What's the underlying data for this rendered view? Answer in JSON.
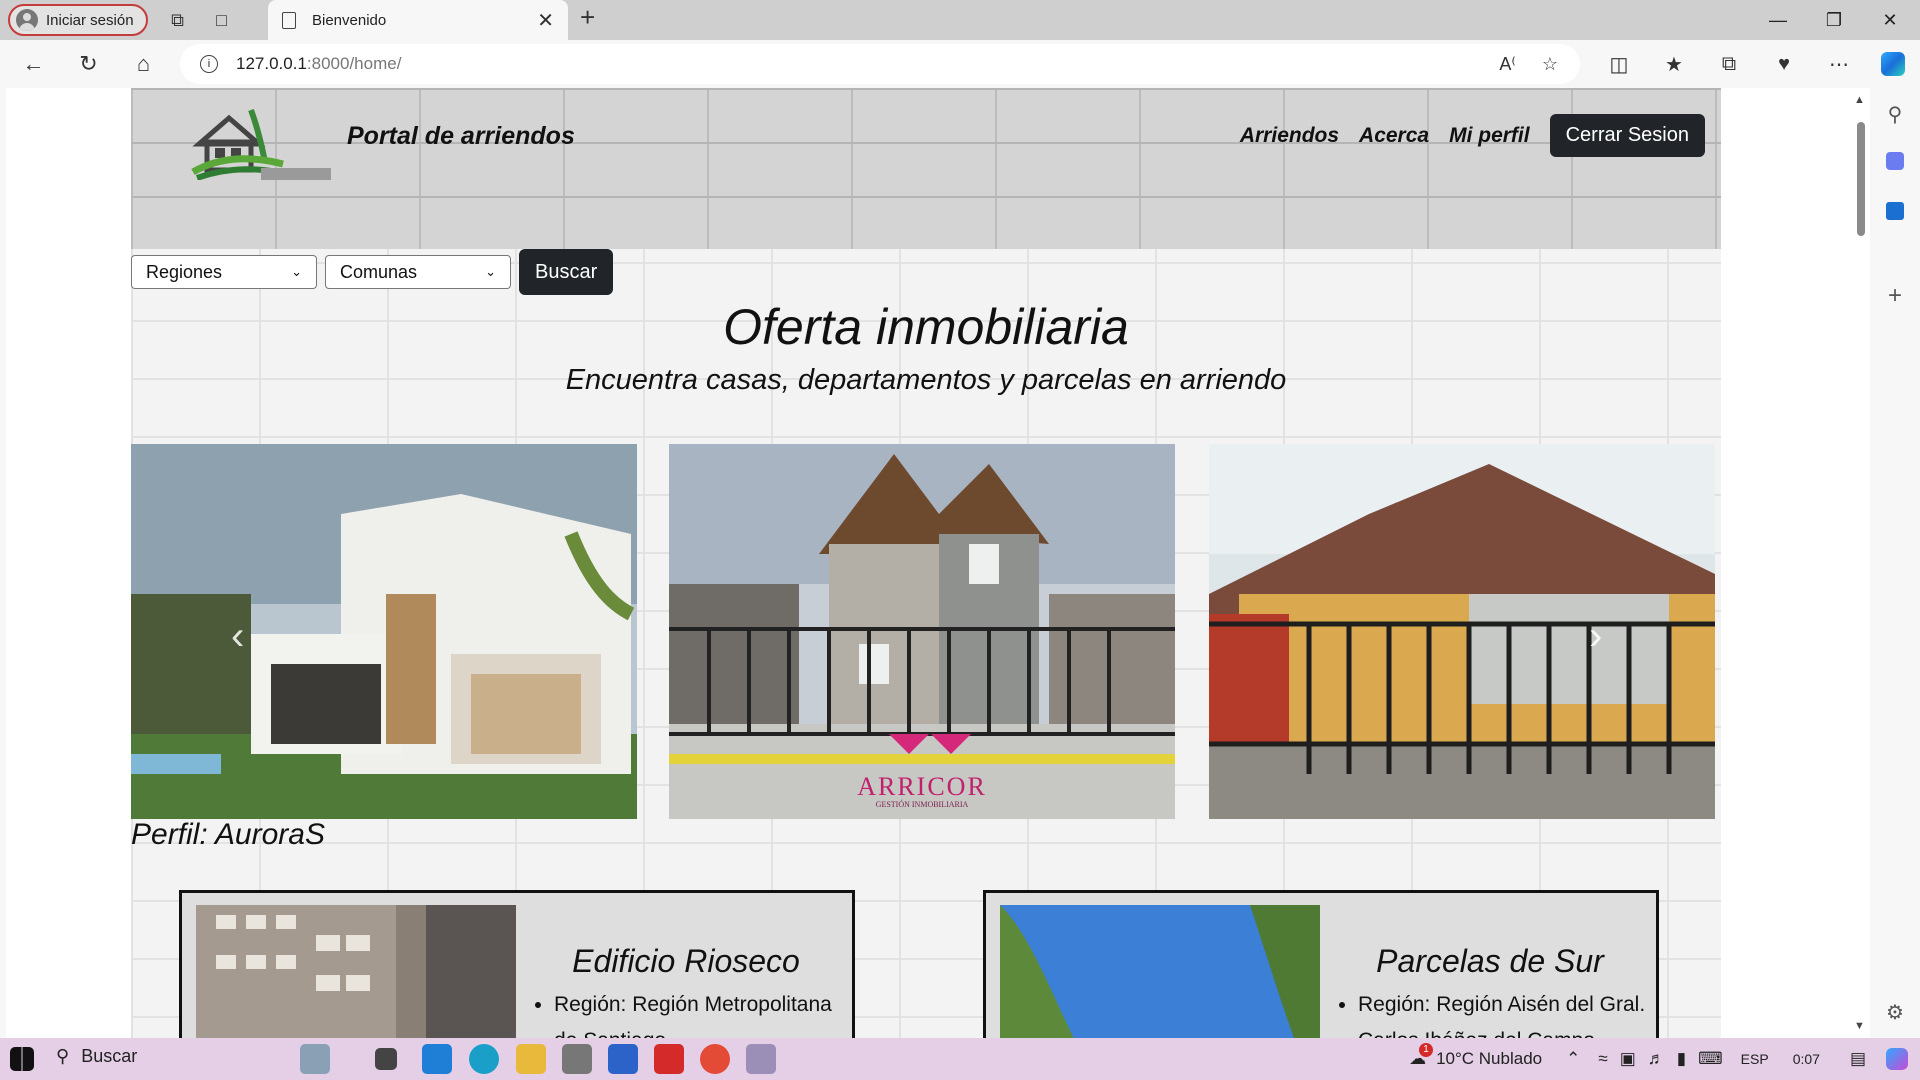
{
  "browser": {
    "profile_label": "Iniciar sesión",
    "tab_title": "Bienvenido",
    "url_host": "127.0.0.1",
    "url_rest": ":8000/home/"
  },
  "site": {
    "title": "Portal de arriendos",
    "nav": [
      "Arriendos",
      "Acerca",
      "Mi perfil"
    ],
    "logout_label": "Cerrar Sesion",
    "filters": {
      "region": "Regiones",
      "comuna": "Comunas",
      "search_label": "Buscar"
    },
    "heading": "Oferta inmobiliaria",
    "subheading": "Encuentra casas, departamentos y parcelas en arriendo",
    "carousel": {
      "slide2_brand": "ARRICOR",
      "slide2_tagline": "GESTIÓN INMOBILIARIA"
    },
    "profile_label": "Perfil: AuroraS",
    "cards": [
      {
        "title": "Edificio Rioseco",
        "bullet_1": "Región: Región Metropolitana de Santiago"
      },
      {
        "title": "Parcelas de Sur",
        "bullet_1": "Región: Región Aisén del Gral. Carlos Ibáñez del Campo"
      }
    ]
  },
  "taskbar": {
    "search_label": "Buscar",
    "weather": "10°C  Nublado",
    "weather_badge": "1",
    "lang": "ESP",
    "time": "0:07"
  }
}
